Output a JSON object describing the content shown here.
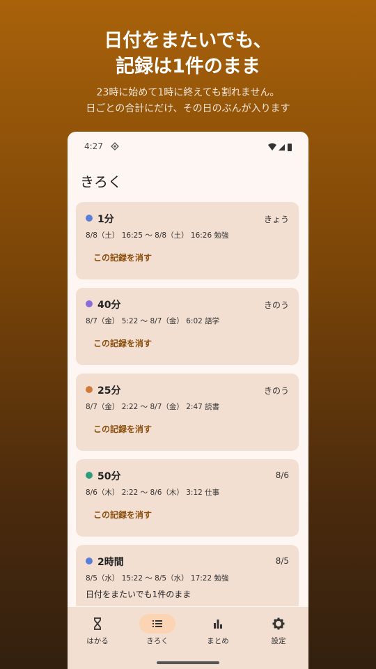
{
  "promo": {
    "title_line1": "日付をまたいでも、",
    "title_line2": "記録は1件のまま",
    "sub_line1": "23時に始めて1時に終えても割れません。",
    "sub_line2": "日ごとの合計にだけ、その日のぶんが入ります"
  },
  "status_bar": {
    "time": "4:27"
  },
  "page": {
    "title": "きろく"
  },
  "records": [
    {
      "duration": "1分",
      "when": "きょう",
      "range": "8/8（土） 16:25 〜 8/8（土） 16:26 勉強",
      "delete_label": "この記録を消す",
      "color": "#5b7fd6"
    },
    {
      "duration": "40分",
      "when": "きのう",
      "range": "8/7（金） 5:22 〜 8/7（金） 6:02 語学",
      "delete_label": "この記録を消す",
      "color": "#8a6bd8"
    },
    {
      "duration": "25分",
      "when": "きのう",
      "range": "8/7（金） 2:22 〜 8/7（金） 2:47 読書",
      "delete_label": "この記録を消す",
      "color": "#d07a3a"
    },
    {
      "duration": "50分",
      "when": "8/6",
      "range": "8/6（木） 2:22 〜 8/6（木） 3:12 仕事",
      "delete_label": "この記録を消す",
      "color": "#2e9c7e"
    },
    {
      "duration": "2時間",
      "when": "8/5",
      "range": "8/5（水） 15:22 〜 8/5（水） 17:22 勉強",
      "note": "日付をまたいでも1件のまま",
      "color": "#5b7fd6"
    }
  ],
  "nav": [
    {
      "label": "はかる",
      "icon": "hourglass-icon"
    },
    {
      "label": "きろく",
      "icon": "list-icon",
      "active": true
    },
    {
      "label": "まとめ",
      "icon": "bar-chart-icon"
    },
    {
      "label": "設定",
      "icon": "gear-icon"
    }
  ]
}
